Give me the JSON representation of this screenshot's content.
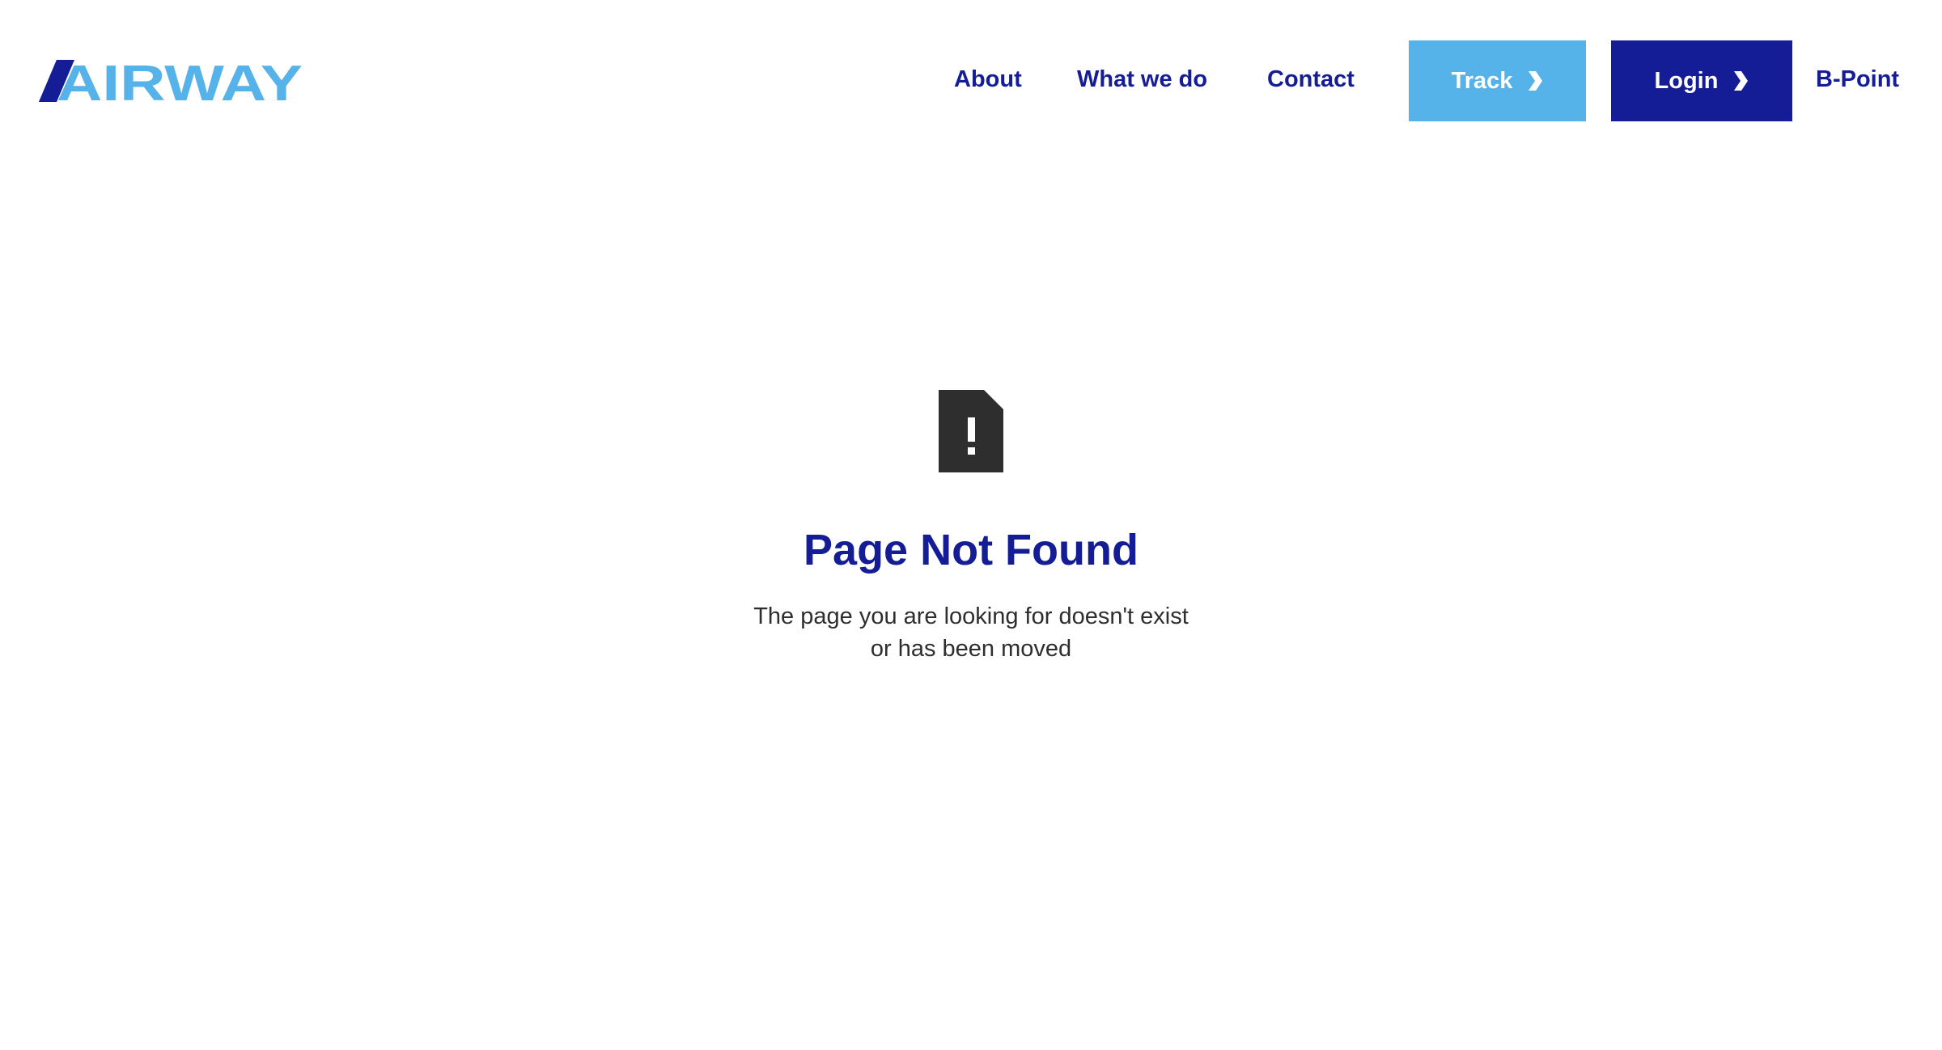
{
  "brand": {
    "logo_text": "AIRWAY",
    "colors": {
      "primary": "#141d96",
      "accent": "#56b3e9",
      "text": "#2e2e2e",
      "icon": "#2e2e2e"
    }
  },
  "nav": {
    "links": [
      {
        "label": "About"
      },
      {
        "label": "What we do"
      },
      {
        "label": "Contact"
      }
    ],
    "track_button": {
      "label": "Track",
      "icon": "chevron-right-icon"
    },
    "login_button": {
      "label": "Login",
      "icon": "chevron-right-icon"
    },
    "bpoint_link": {
      "label": "B-Point"
    }
  },
  "error": {
    "icon": "file-alert-icon",
    "title": "Page Not Found",
    "message": "The page you are looking for doesn't exist or has been moved"
  }
}
